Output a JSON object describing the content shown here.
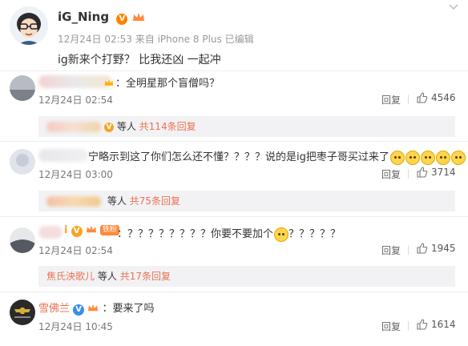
{
  "post": {
    "author": "iG_Ning",
    "meta": "12月24日 02:53 来自 iPhone 8 Plus 已编辑",
    "text": "ig新来个打野？  比我还凶 一起冲"
  },
  "labels": {
    "reply": "回复"
  },
  "comments": [
    {
      "text": "：全明星那个盲僧吗？",
      "time": "12月24日 02:54",
      "likes": "4546",
      "sub": {
        "suffix": "等人",
        "count": "共114条回复"
      }
    },
    {
      "text": "宁略示到这了你们怎么还不懂？？？？说的是ig把枣子哥买过来了",
      "time": "12月24日 03:00",
      "likes": "3714",
      "sub": {
        "suffix": "等人",
        "count": "共75条回复"
      }
    },
    {
      "badge": "铁粉",
      "text": "：？？？？？？？？你要不要加个",
      "text2": "？？？？？",
      "time": "12月24日 02:54",
      "likes": "1945",
      "sub": {
        "name": "焦氏泱歌儿",
        "suffix": "等人",
        "count": "共17条回复"
      }
    },
    {
      "name": "雪佛兰",
      "text": "：要来了吗",
      "time": "12月24日 10:45",
      "likes": "1614"
    }
  ],
  "colors": {
    "accent_orange": "#eb7350",
    "verified_orange": "#ff8200",
    "verified_blue": "#3a8df0",
    "sub_bg": "#f2f2f5"
  }
}
